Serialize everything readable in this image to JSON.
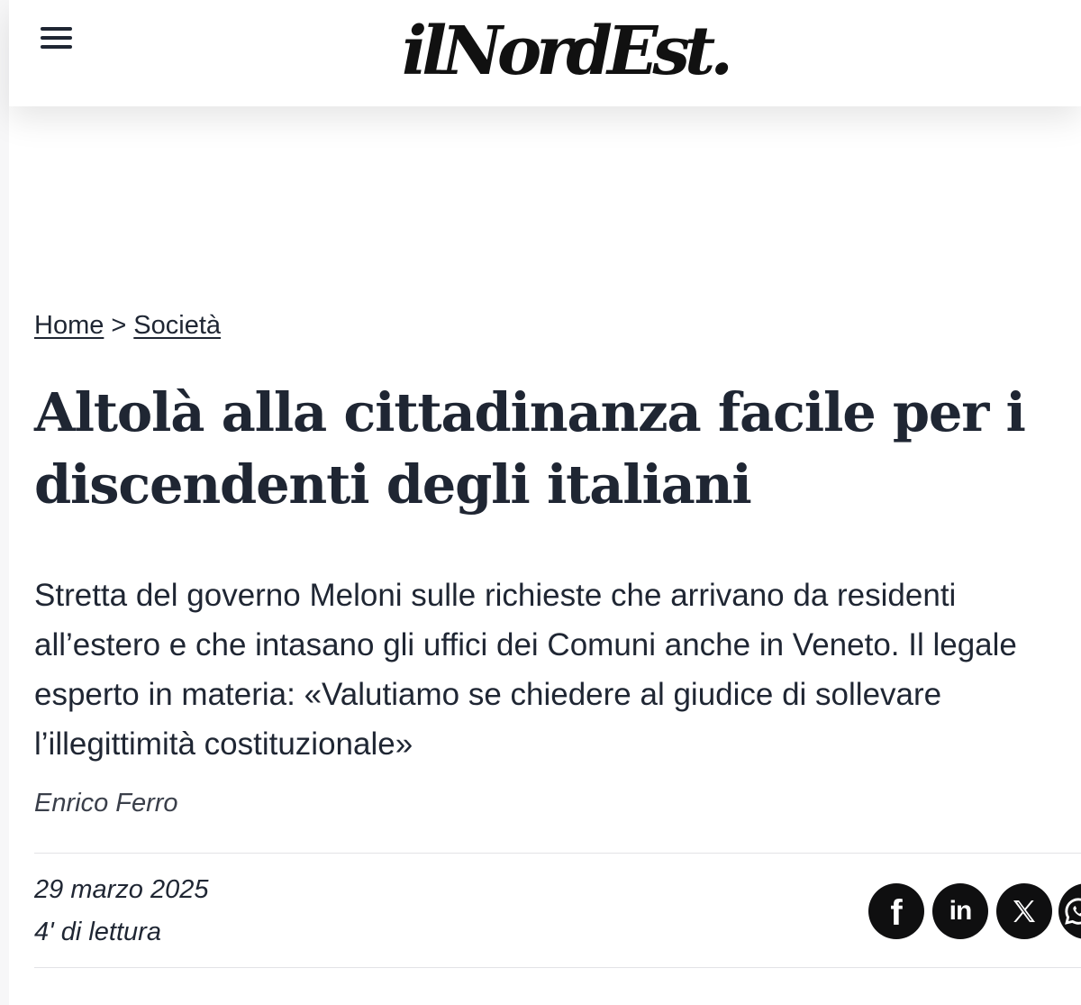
{
  "header": {
    "logo_text": "ilNordEst."
  },
  "breadcrumb": {
    "items": [
      {
        "label": "Home"
      },
      {
        "label": "Società"
      }
    ],
    "separator": ">"
  },
  "article": {
    "title": "Altolà alla cittadinanza facile per i discendenti degli italiani",
    "subtitle": "Stretta del governo Meloni sulle richieste che arrivano da residenti all’estero e che intasano gli uffici dei Comuni anche in Veneto. Il legale esperto in materia: «Valutiamo se chiedere al giudice di sollevare l’illegittimità costituzionale»",
    "author": "Enrico Ferro",
    "date": "29 marzo 2025",
    "reading_time": "4' di lettura"
  },
  "share": {
    "facebook_glyph": "f",
    "linkedin_glyph": "in",
    "icons": [
      "facebook-icon",
      "linkedin-icon",
      "x-icon",
      "whatsapp-icon"
    ]
  },
  "colors": {
    "text": "#1f2633",
    "share_bg": "#0f0f10",
    "rule": "#e3e3e6"
  }
}
